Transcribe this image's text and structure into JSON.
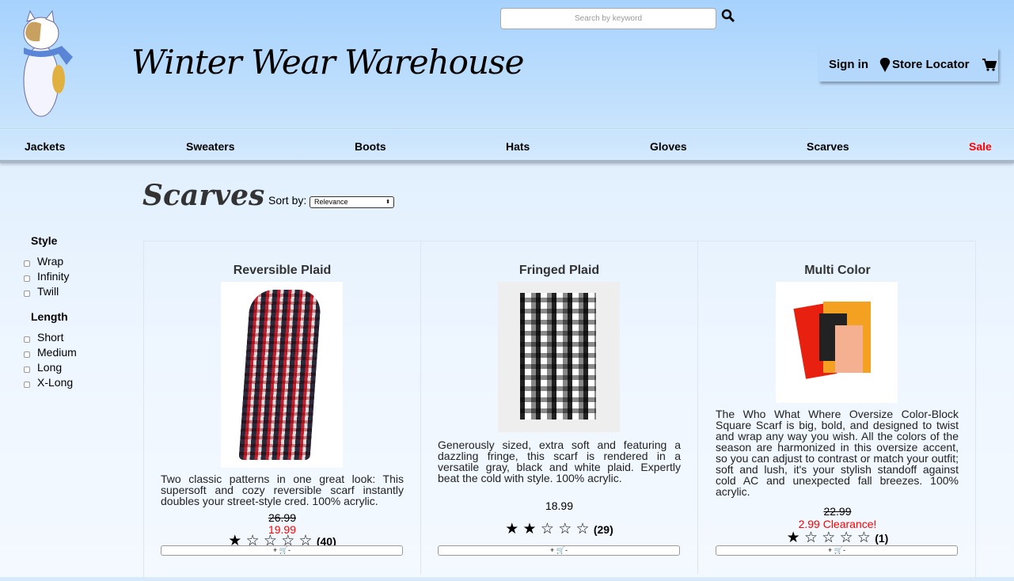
{
  "header": {
    "title": "Winter Wear Warehouse",
    "search_placeholder": "Search by keyword",
    "sign_in": "Sign in",
    "store_locator": "Store Locator"
  },
  "nav": [
    "Jackets",
    "Sweaters",
    "Boots",
    "Hats",
    "Gloves",
    "Scarves",
    "Sale"
  ],
  "colors": {
    "sale": "#ff0000",
    "header_top": "#a6d2fd"
  },
  "page": {
    "title": "Scarves",
    "sort_label": "Sort by:",
    "sort_value": "Relevance"
  },
  "filters": {
    "style_title": "Style",
    "style": [
      "Wrap",
      "Infinity",
      "Twill"
    ],
    "length_title": "Length",
    "length": [
      "Short",
      "Medium",
      "Long",
      "X-Long"
    ]
  },
  "products": [
    {
      "name": "Reversible Plaid",
      "desc": "Two classic patterns in one great look: This supersoft and cozy reversible scarf instantly doubles your street-style cred. 100% acrylic.",
      "old_price": "26.99",
      "price": "19.99",
      "rating": 1,
      "reviews": "(40)"
    },
    {
      "name": "Fringed Plaid",
      "desc": "Generously sized, extra soft and featuring a dazzling fringe, this scarf is rendered in a versatile gray, black and white plaid. Expertly beat the cold with style. 100% acrylic.",
      "price": "18.99",
      "rating": 2,
      "reviews": "(29)"
    },
    {
      "name": "Multi Color",
      "desc": "The Who What Where Oversize Color-Block Square Scarf is big, bold, and designed to twist and wrap any way you wish. All the colors of the season are harmonized in this oversize accent, so you can adjust to contrast or match your outfit; soft and lush, it's your stylish standoff against cold AC and unexpected fall breezes. 100% acrylic.",
      "old_price": "22.99",
      "price": "2.99 Clearance!",
      "rating": 1,
      "reviews": "(1)"
    }
  ],
  "cart_button": {
    "plus": "+",
    "minus": "-"
  }
}
